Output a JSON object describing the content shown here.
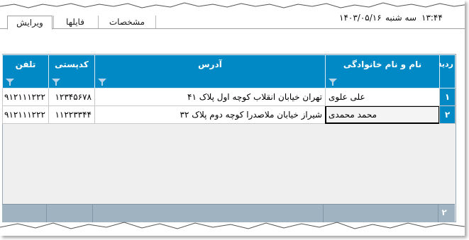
{
  "tabs": [
    {
      "label": "ویرایش",
      "active": true
    },
    {
      "label": "فایلها",
      "active": false
    },
    {
      "label": "مشخصات",
      "active": false
    }
  ],
  "datetime": {
    "time": "۱۳:۴۴",
    "weekday": "سه شنبه",
    "date": "۱۴۰۳/۰۵/۱۶"
  },
  "table": {
    "columns": {
      "rownum": "ردیف",
      "name": "نام و نام خانوادگی",
      "address": "آدرس",
      "postal": "کدپستی",
      "phone": "تلفن"
    },
    "rows": [
      {
        "num": "۱",
        "name": "علی علوی",
        "address": "تهران خیابان انقلاب کوچه اول پلاک ۴۱",
        "postal": "۱۲۳۴۵۶۷۸",
        "phone": "۰۹۱۲۱۱۱۲۲۲"
      },
      {
        "num": "۲",
        "name": "محمد محمدی",
        "address": "شیراز خیابان ملاصدرا کوچه دوم پلاک ۳۲",
        "postal": "۱۱۲۲۳۳۴۴",
        "phone": "۰۹۱۲۱۱۱۲۲۲"
      }
    ],
    "footer_count": "۲"
  },
  "colors": {
    "header": "#0089c4",
    "footer": "#9fb3c0"
  }
}
